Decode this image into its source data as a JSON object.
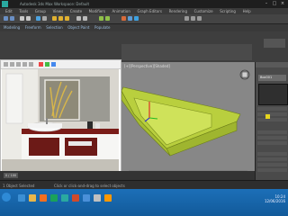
{
  "app": {
    "title": "Autodesk 3ds Max  Workspace: Default"
  },
  "menu": {
    "items": [
      "Edit",
      "Tools",
      "Group",
      "Views",
      "Create",
      "Modifiers",
      "Animation",
      "Graph Editors",
      "Rendering",
      "Customize",
      "Scripting",
      "Help"
    ]
  },
  "ribbon": {
    "tabs": [
      "Modeling",
      "Freeform",
      "Selection",
      "Object Paint",
      "Populate"
    ]
  },
  "viewport": {
    "label": "[+][Perspective][Shaded]"
  },
  "command_panel": {
    "object_name": "Box001",
    "modifier_list": "Modifier List"
  },
  "timeline": {
    "frame": "0 / 100"
  },
  "status": {
    "selected": "1 Object Selected",
    "hint": "Click or click-and-drag to select objects"
  },
  "taskbar": {
    "time": "10:24",
    "date": "12/06/2016"
  },
  "colors": {
    "accent": "#c6dc4e",
    "taskbar": "#1c6fb8"
  }
}
